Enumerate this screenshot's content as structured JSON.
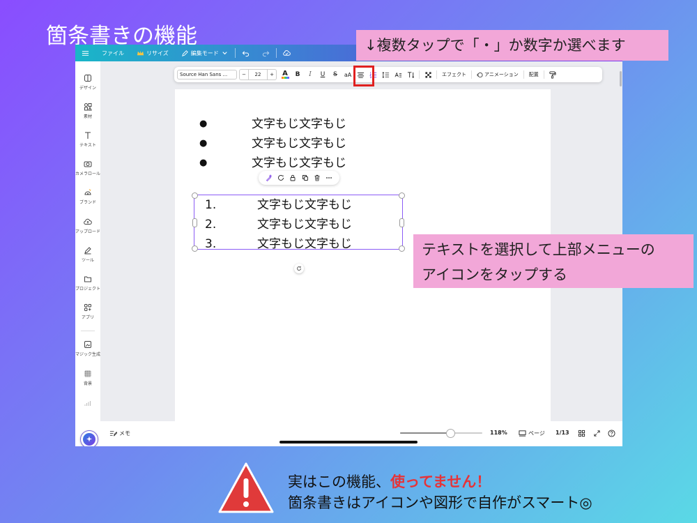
{
  "slide": {
    "title": "箇条書きの機能",
    "callout_top": "↓複数タップで「・」か数字か選べます",
    "callout_right_line1": "テキストを選択して上部メニューの",
    "callout_right_line2": "アイコンをタップする",
    "footer_line1_a": "実はこの機能、",
    "footer_line1_b": "使ってません！",
    "footer_line2": "箇条書きはアイコンや図形で自作がスマート◎",
    "warning_icon": "warning-triangle-icon",
    "colors": {
      "callout_bg": "#f2a7d8",
      "emphasis_red": "#e63338",
      "highlight_red": "#e02020",
      "selection": "#8b5cf6"
    }
  },
  "topbar": {
    "menu_icon": "hamburger-icon",
    "file": "ファイル",
    "resize": "リサイズ",
    "edit_mode": "編集モード",
    "icons": [
      "crown-icon",
      "pencil-icon",
      "chevron-down-icon",
      "undo-icon",
      "redo-icon",
      "cloud-icon"
    ]
  },
  "sidebar": {
    "items": [
      {
        "icon": "design-icon",
        "label": "デザイン"
      },
      {
        "icon": "elements-icon",
        "label": "素材"
      },
      {
        "icon": "text-icon",
        "label": "テキスト"
      },
      {
        "icon": "camera-icon",
        "label": "カメラロール"
      },
      {
        "icon": "brand-icon",
        "label": "ブランド"
      },
      {
        "icon": "upload-icon",
        "label": "アップロード"
      },
      {
        "icon": "tools-icon",
        "label": "ツール"
      },
      {
        "icon": "folder-icon",
        "label": "プロジェクト"
      },
      {
        "icon": "apps-icon",
        "label": "アプリ"
      },
      {
        "icon": "magic-generate-icon",
        "label": "マジック生成"
      },
      {
        "icon": "background-icon",
        "label": "背景"
      }
    ]
  },
  "toolbar": {
    "font_name": "Source Han Sans ...",
    "font_minus": "−",
    "font_size": "22",
    "font_plus": "+",
    "text_color_label": "A",
    "bold_label": "B",
    "italic_label": "I",
    "underline_label": "U",
    "strike_label": "S",
    "case_label": "aA",
    "effects": "エフェクト",
    "animation": "アニメーション",
    "position": "配置"
  },
  "canvas": {
    "bullet_marker": "●",
    "bullet_items": [
      "文字もじ文字もじ",
      "文字もじ文字もじ",
      "文字もじ文字もじ"
    ],
    "numbered_items": [
      {
        "num": "1.",
        "text": "文字もじ文字もじ"
      },
      {
        "num": "2.",
        "text": "文字もじ文字もじ"
      },
      {
        "num": "3.",
        "text": "文字もじ文字もじ"
      }
    ],
    "float_toolbar_icons": [
      "magic-pen-icon",
      "comment-icon",
      "lock-icon",
      "duplicate-icon",
      "trash-icon",
      "more-icon"
    ]
  },
  "bottombar": {
    "notes": "メモ",
    "zoom": "118%",
    "zoom_level_fraction": 0.6,
    "pages": "ページ",
    "page_count": "1/13"
  }
}
